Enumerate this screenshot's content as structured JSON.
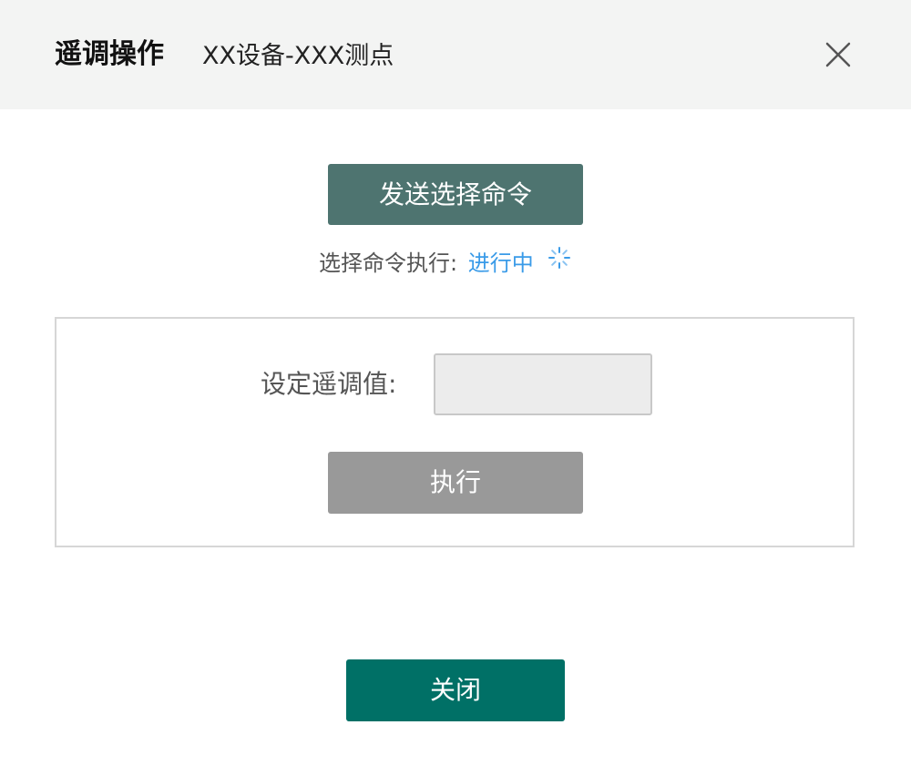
{
  "header": {
    "title": "遥调操作",
    "subtitle": "XX设备-XXX测点",
    "close_icon": "close-icon"
  },
  "select_command": {
    "button_label": "发送选择命令",
    "status_label": "选择命令执行:",
    "status_value": "进行中",
    "status_icon": "loading-spinner-icon"
  },
  "setpoint_panel": {
    "field_label": "设定遥调值:",
    "input_value": "",
    "execute_label": "执行"
  },
  "footer": {
    "close_label": "关闭"
  },
  "colors": {
    "header_bg": "#f3f4f3",
    "send_button": "#4e7470",
    "status_accent": "#3a9be8",
    "execute_button_disabled": "#999999",
    "close_button": "#007066"
  }
}
